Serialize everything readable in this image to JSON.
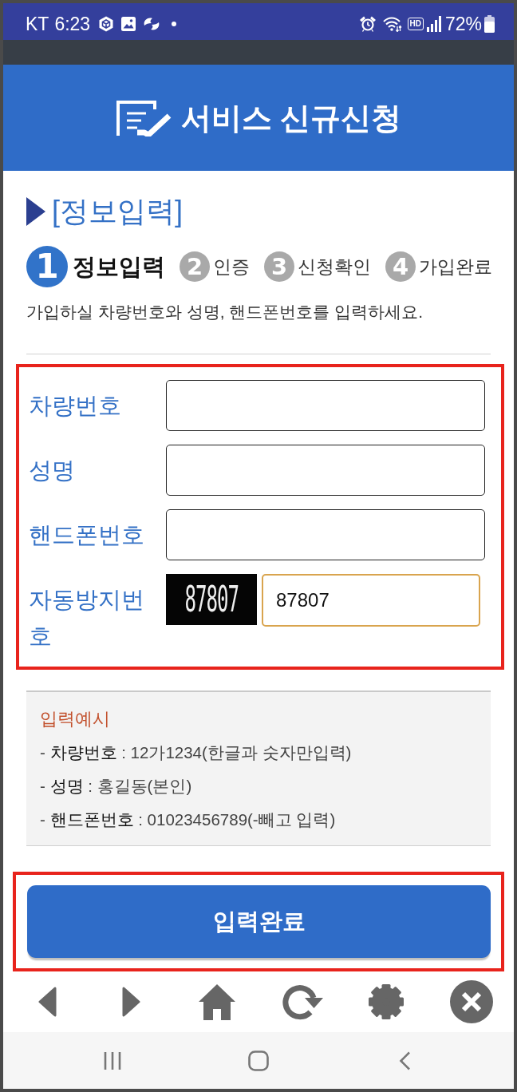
{
  "status_bar": {
    "carrier": "KT",
    "time": "6:23",
    "network_badge": "HD",
    "battery": "72%"
  },
  "header": {
    "title": "서비스 신규신청"
  },
  "section": {
    "title": "[정보입력]"
  },
  "steps": [
    {
      "number": "1",
      "label": "정보입력",
      "selected": true
    },
    {
      "number": "2",
      "label": "인증",
      "selected": false
    },
    {
      "number": "3",
      "label": "신청확인",
      "selected": false
    },
    {
      "number": "4",
      "label": "가입완료",
      "selected": false
    }
  ],
  "instruction": "가입하실 차량번호와 성명, 핸드폰번호를 입력하세요.",
  "form": {
    "highlighted": true,
    "fields": [
      {
        "kind": "text",
        "label": "차량번호",
        "focused": false
      },
      {
        "kind": "text",
        "label": "성명",
        "focused": false
      },
      {
        "kind": "text",
        "label": "핸드폰번호",
        "focused": false
      },
      {
        "kind": "captcha",
        "label": "자동방지번호",
        "captcha_text": "87807",
        "value": "87807",
        "focused": true
      }
    ]
  },
  "example": {
    "title": "입력예시",
    "lines": [
      "- **차량번호** : 12가1234(한글과 숫자만입력)",
      "- **성명** : 홍길동(본인)",
      "- **핸드폰번호** : 01023456789(-빼고 입력)"
    ]
  },
  "submit": {
    "label": "입력완료",
    "highlighted": true
  }
}
